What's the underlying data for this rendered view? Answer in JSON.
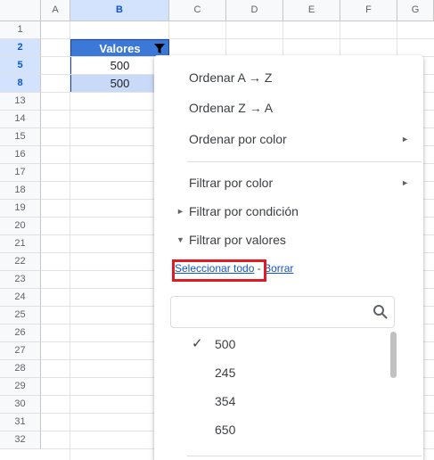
{
  "columns": [
    "A",
    "B",
    "C",
    "D",
    "E",
    "F",
    "G"
  ],
  "rows": [
    "1",
    "2",
    "5",
    "8",
    "13",
    "14",
    "15",
    "16",
    "17",
    "18",
    "19",
    "20",
    "21",
    "22",
    "23",
    "24",
    "25",
    "26",
    "27",
    "28",
    "29",
    "30",
    "31",
    "32"
  ],
  "selected_column": "B",
  "selected_rows": [
    "2",
    "5",
    "8"
  ],
  "table": {
    "header": "Valores",
    "values": [
      "500",
      "500"
    ]
  },
  "menu": {
    "sort_az": "Ordenar A → Z",
    "sort_za": "Ordenar Z → A",
    "sort_by_color": "Ordenar por color",
    "filter_by_color": "Filtrar por color",
    "filter_by_condition": "Filtrar por condición",
    "filter_by_values": "Filtrar por valores",
    "select_all": "Seleccionar todo",
    "separator": " - ",
    "clear": "Borrar",
    "search_placeholder": "",
    "value_items": [
      {
        "label": "500",
        "checked": true
      },
      {
        "label": "245",
        "checked": false
      },
      {
        "label": "354",
        "checked": false
      },
      {
        "label": "650",
        "checked": false
      }
    ]
  },
  "colors": {
    "header_fill": "#3c78d8",
    "alt_row_fill": "#c9daf8",
    "selection": "#d3e3fd",
    "highlight_box": "#e01b24",
    "link": "#1155cc"
  }
}
